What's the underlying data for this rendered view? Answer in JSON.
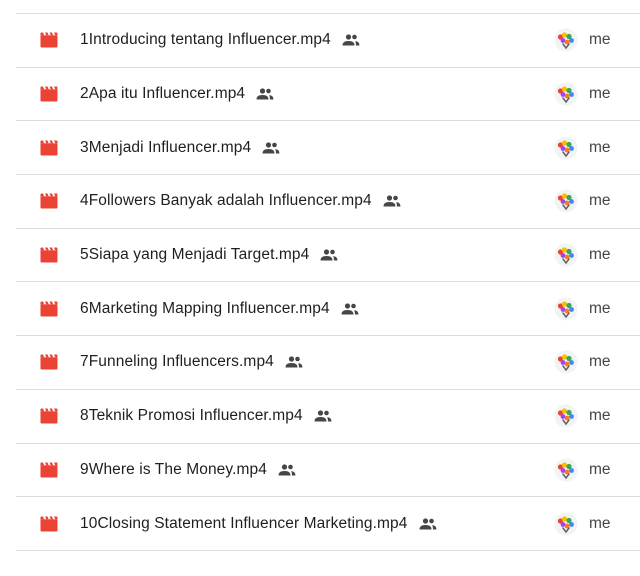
{
  "files": [
    {
      "name": "1Introducing tentang Influencer.mp4",
      "icon": "video-file-icon",
      "shared": true,
      "owner": "me"
    },
    {
      "name": "2Apa itu Influencer.mp4",
      "icon": "video-file-icon",
      "shared": true,
      "owner": "me"
    },
    {
      "name": "3Menjadi Influencer.mp4",
      "icon": "video-file-icon",
      "shared": true,
      "owner": "me"
    },
    {
      "name": "4Followers Banyak adalah Influencer.mp4",
      "icon": "video-file-icon",
      "shared": true,
      "owner": "me"
    },
    {
      "name": "5Siapa yang Menjadi Target.mp4",
      "icon": "video-file-icon",
      "shared": true,
      "owner": "me"
    },
    {
      "name": "6Marketing Mapping Influencer.mp4",
      "icon": "video-file-icon",
      "shared": true,
      "owner": "me"
    },
    {
      "name": "7Funneling Influencers.mp4",
      "icon": "video-file-icon",
      "shared": true,
      "owner": "me"
    },
    {
      "name": "8Teknik Promosi Influencer.mp4",
      "icon": "video-file-icon",
      "shared": true,
      "owner": "me"
    },
    {
      "name": "9Where is The Money.mp4",
      "icon": "video-file-icon",
      "shared": true,
      "owner": "me"
    },
    {
      "name": "10Closing Statement Influencer Marketing.mp4",
      "icon": "video-file-icon",
      "shared": true,
      "owner": "me"
    }
  ],
  "colors": {
    "video_icon": "#ea4335",
    "shared_icon": "#444746",
    "divider": "#dadce0",
    "text": "#1f1f1f",
    "owner_text": "#444746"
  }
}
